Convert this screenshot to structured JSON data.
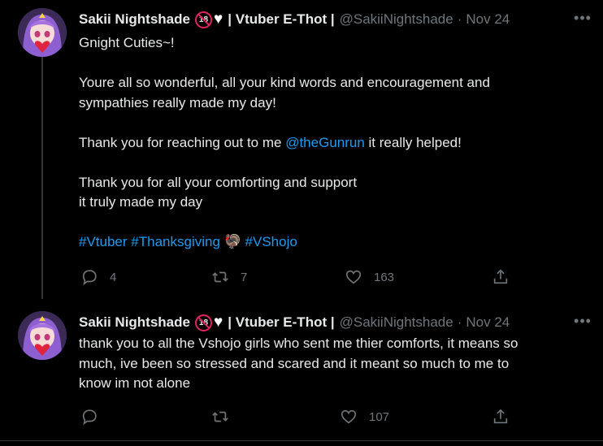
{
  "tweets": [
    {
      "display_name": "Sakii Nightshade",
      "badge": "18",
      "name_suffix": "| Vtuber E-Thot |",
      "handle": "@SakiiNightshade",
      "date": "Nov 24",
      "text": {
        "l1": "Gnight Cuties~!",
        "l2": "Youre all so wonderful, all your kind words and encouragement and",
        "l3": "sympathies really made my day!",
        "l4a": "Thank you for reaching out to me ",
        "l4_mention": "@theGunrun",
        "l4b": " it really helped!",
        "l5": "Thank you for all your comforting and support",
        "l6": "it truly made my day",
        "hashtag1": "#Vtuber",
        "hashtag2": "#Thanksgiving",
        "emoji": "🦃",
        "hashtag3": "#VShojo"
      },
      "replies": "4",
      "retweets": "7",
      "likes": "163"
    },
    {
      "display_name": "Sakii Nightshade",
      "badge": "18",
      "name_suffix": "| Vtuber E-Thot |",
      "handle": "@SakiiNightshade",
      "date": "Nov 24",
      "text": {
        "l1": "thank you to all the Vshojo girls who sent me thier comforts, it means so",
        "l2": "much, ive been so stressed and scared and it meant so much to me to",
        "l3": "know im not alone"
      },
      "replies": "",
      "retweets": "",
      "likes": "107"
    }
  ],
  "icons": {
    "more": "more-horizontal-icon",
    "reply": "reply-bubble-icon",
    "retweet": "retweet-arrows-icon",
    "like": "heart-outline-icon",
    "share": "share-upload-icon"
  },
  "colors": {
    "background": "#000000",
    "text": "#e7e9ea",
    "muted": "#71767b",
    "link": "#1d9bf0"
  }
}
